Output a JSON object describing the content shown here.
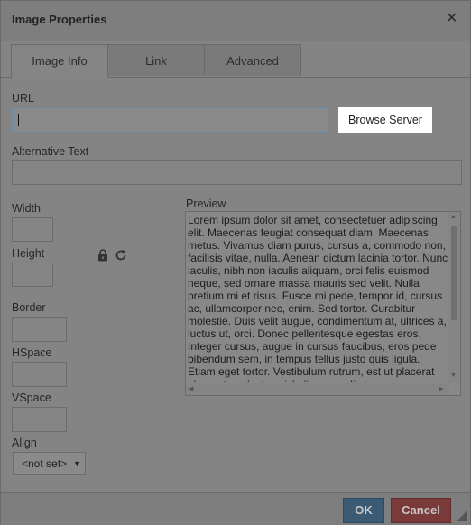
{
  "dialog": {
    "title": "Image Properties",
    "close_icon": "close-icon"
  },
  "tabs": [
    {
      "label": "Image Info",
      "active": true
    },
    {
      "label": "Link",
      "active": false
    },
    {
      "label": "Advanced",
      "active": false
    }
  ],
  "url": {
    "label": "URL",
    "value": "",
    "browse_label": "Browse Server"
  },
  "alt_text": {
    "label": "Alternative Text",
    "value": ""
  },
  "fields": {
    "width": {
      "label": "Width",
      "value": ""
    },
    "height": {
      "label": "Height",
      "value": ""
    },
    "border": {
      "label": "Border",
      "value": ""
    },
    "hspace": {
      "label": "HSpace",
      "value": ""
    },
    "vspace": {
      "label": "VSpace",
      "value": ""
    },
    "align": {
      "label": "Align",
      "selected": "<not set>"
    }
  },
  "icons": {
    "lock": "lock-icon",
    "reset": "reset-size-icon"
  },
  "preview": {
    "label": "Preview",
    "text": "Lorem ipsum dolor sit amet, consectetuer adipiscing elit. Maecenas feugiat consequat diam. Maecenas metus. Vivamus diam purus, cursus a, commodo non, facilisis vitae, nulla. Aenean dictum lacinia tortor. Nunc iaculis, nibh non iaculis aliquam, orci felis euismod neque, sed ornare massa mauris sed velit. Nulla pretium mi et risus. Fusce mi pede, tempor id, cursus ac, ullamcorper nec, enim. Sed tortor. Curabitur molestie. Duis velit augue, condimentum at, ultrices a, luctus ut, orci. Donec pellentesque egestas eros. Integer cursus, augue in cursus faucibus, eros pede bibendum sem, in tempus tellus justo quis ligula. Etiam eget tortor. Vestibulum rutrum, est ut placerat elementum, lectus nisl aliquam velit, tempor"
  },
  "footer": {
    "ok_label": "OK",
    "cancel_label": "Cancel"
  },
  "colors": {
    "ok": "#3b5a74",
    "cancel": "#7a3a3a",
    "overlay": "#7f7f7f"
  }
}
